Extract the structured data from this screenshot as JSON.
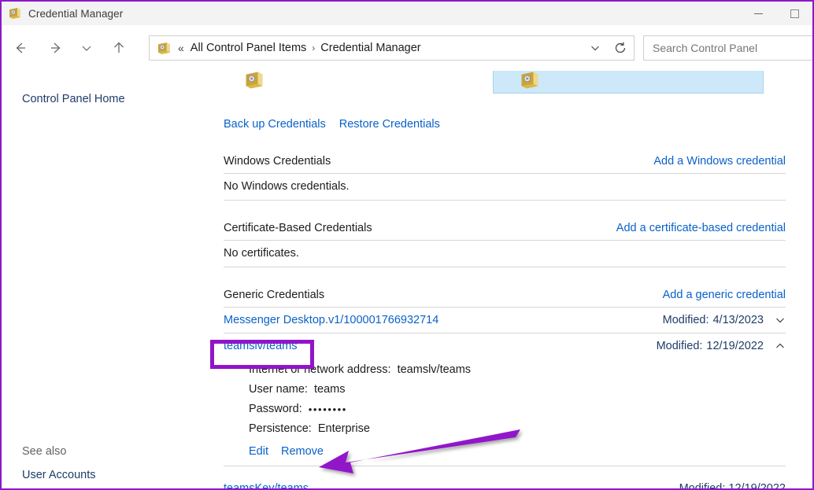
{
  "window": {
    "title": "Credential Manager",
    "icon": "credential-vault-icon",
    "minimize_label": "Minimize",
    "maximize_label": "Maximize"
  },
  "nav": {
    "back_label": "Back",
    "forward_label": "Forward",
    "recent_label": "Recent locations",
    "up_label": "Up one level",
    "refresh_label": "Refresh",
    "dropdown_label": "Previous locations"
  },
  "address": {
    "icon": "credential-vault-icon",
    "overflow": "«",
    "crumbs": [
      "All Control Panel Items",
      "Credential Manager"
    ],
    "separator": "›"
  },
  "search": {
    "placeholder": "Search Control Panel",
    "value": ""
  },
  "sidebar": {
    "home": "Control Panel Home",
    "see_also_label": "See also",
    "user_accounts": "User Accounts"
  },
  "main": {
    "backup_link": "Back up Credentials",
    "restore_link": "Restore Credentials",
    "sections": [
      {
        "title": "Windows Credentials",
        "action": "Add a Windows credential",
        "empty": "No Windows credentials."
      },
      {
        "title": "Certificate-Based Credentials",
        "action": "Add a certificate-based credential",
        "empty": "No certificates."
      },
      {
        "title": "Generic Credentials",
        "action": "Add a generic credential",
        "empty": ""
      }
    ],
    "credentials": [
      {
        "name": "Messenger Desktop.v1/100001766932714",
        "modified_label": "Modified:",
        "modified_date": "4/13/2023",
        "expanded": false,
        "chevron": "chevron-down-icon"
      },
      {
        "name": "teamslv/teams",
        "modified_label": "Modified:",
        "modified_date": "12/19/2022",
        "expanded": true,
        "chevron": "chevron-up-icon",
        "details": {
          "address_label": "Internet or network address:",
          "address_value": "teamslv/teams",
          "username_label": "User name:",
          "username_value": "teams",
          "password_label": "Password:",
          "password_value": "••••••••",
          "persistence_label": "Persistence:",
          "persistence_value": "Enterprise",
          "edit_link": "Edit",
          "remove_link": "Remove"
        }
      }
    ]
  },
  "annotations": {
    "highlight_color": "#9214c9",
    "highlight_target": "teamslv/teams",
    "arrow_color": "#9214c9",
    "arrow_target": "Remove"
  }
}
